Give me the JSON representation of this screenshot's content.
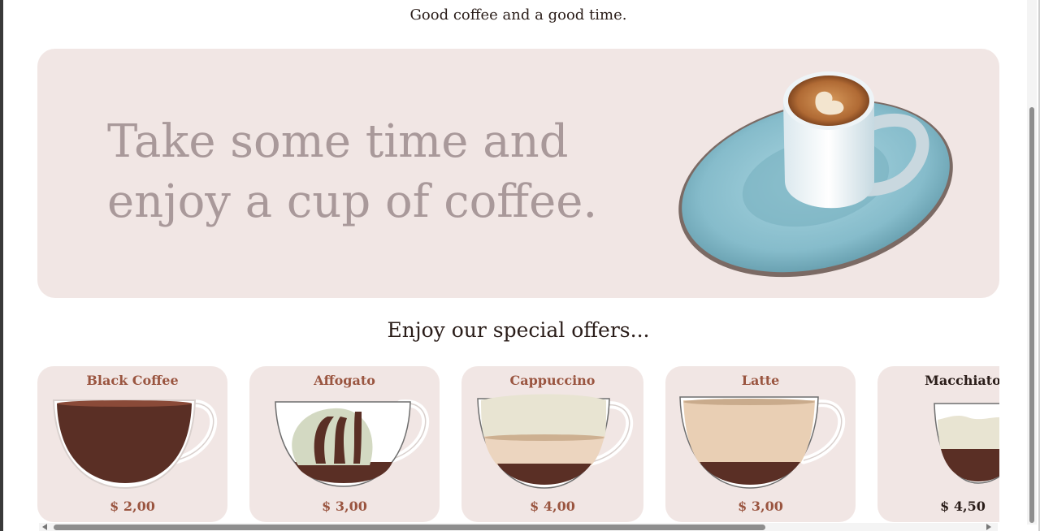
{
  "header": {
    "tagline": "Good coffee and a good time."
  },
  "hero": {
    "line1": "Take some time and",
    "line2": "enjoy a cup of coffee."
  },
  "offers": {
    "title": "Enjoy our special offers...",
    "items": [
      {
        "name": "Black Coffee",
        "price": "$ 2,00",
        "icon": "black-coffee-cup-icon"
      },
      {
        "name": "Affogato",
        "price": "$ 3,00",
        "icon": "affogato-cup-icon"
      },
      {
        "name": "Cappuccino",
        "price": "$ 4,00",
        "icon": "cappuccino-cup-icon"
      },
      {
        "name": "Latte",
        "price": "$ 3,00",
        "icon": "latte-cup-icon"
      },
      {
        "name": "Macchiato",
        "price": "$ 4,50",
        "icon": "macchiato-cup-icon"
      }
    ]
  },
  "colors": {
    "card_bg": "#f1e6e4",
    "accent": "#9a5540",
    "hero_text": "#a9999a",
    "coffee_dark": "#5a2f25"
  }
}
